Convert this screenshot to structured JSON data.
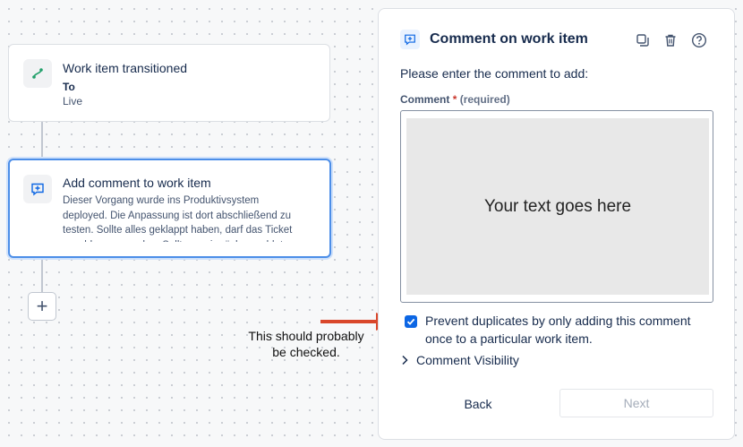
{
  "canvas": {
    "node1": {
      "title": "Work item transitioned",
      "label": "To",
      "value": "Live",
      "icon": "transition-icon"
    },
    "node2": {
      "title": "Add comment to work item",
      "description": "Dieser Vorgang wurde ins Produktivsystem deployed. Die Anpassung ist dort abschließend zu testen. Sollte alles geklappt haben, darf das Ticket geschlossen werden. Sollte es ein rückgemeldet werden.",
      "icon": "comment-add-icon",
      "selected": true
    },
    "add_button_icon": "plus-icon",
    "annotation": {
      "line1": "This should probably",
      "line2": "be checked.",
      "arrow_color": "#d9472b"
    }
  },
  "panel": {
    "title": "Comment on work item",
    "tools": [
      "duplicate-icon",
      "trash-icon",
      "help-icon"
    ],
    "prompt": "Please enter the comment to add:",
    "field_label": "Comment",
    "required_mark": "*",
    "required_text": "(required)",
    "textarea_placeholder": "Your text goes here",
    "prevent_duplicates": {
      "checked": true,
      "label": "Prevent duplicates by only adding this comment once to a particular work item."
    },
    "visibility_label": "Comment Visibility",
    "back_label": "Back",
    "next_label": "Next"
  },
  "colors": {
    "accent": "#0c66e4",
    "selected_border": "#4c8ee8"
  }
}
